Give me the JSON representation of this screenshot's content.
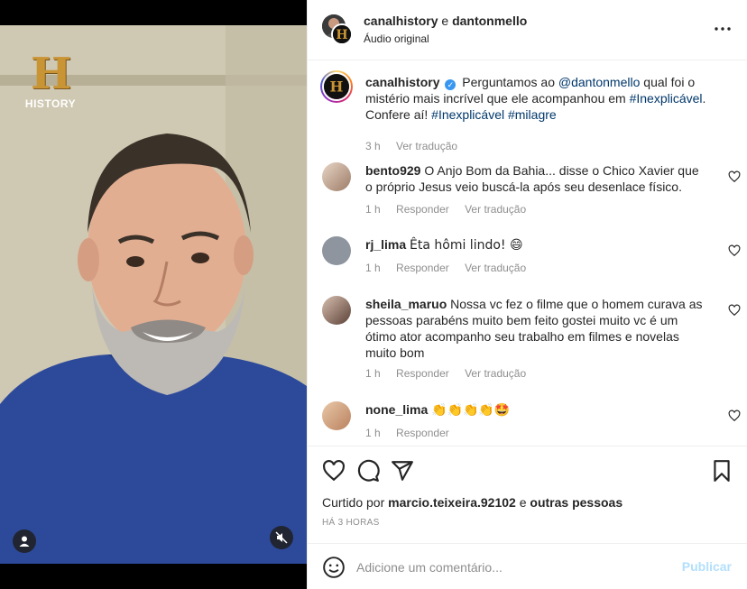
{
  "video": {
    "logo_text": "HISTORY",
    "logo_letter": "H"
  },
  "header": {
    "user1": "canalhistory",
    "joiner": "e",
    "user2": "dantonmello",
    "audio": "Áudio original"
  },
  "caption": {
    "user": "canalhistory",
    "text_1": "Perguntamos ao",
    "mention": "@dantonmello",
    "text_2": "qual foi o mistério mais incrível que ele acompanhou em",
    "tag1": "#Inexplicável",
    "text_3": ". Confere aí!",
    "tag2": "#Inexplicável",
    "tag3": "#milagre",
    "time": "3 h",
    "translate": "Ver tradução"
  },
  "comments": [
    {
      "user": "bento929",
      "text": "O Anjo Bom da Bahia... disse o Chico Xavier que o próprio Jesus veio buscá-la após seu desenlace físico.",
      "time": "1 h",
      "reply": "Responder",
      "translate": "Ver tradução"
    },
    {
      "user": "rj_lima",
      "text": "Êta hômi lindo! 😄",
      "time": "1 h",
      "reply": "Responder",
      "translate": "Ver tradução"
    },
    {
      "user": "sheila_maruo",
      "text": "Nossa vc fez o filme que o homem curava as pessoas parabéns muito bem feito gostei muito vc é um ótimo ator acompanho seu trabalho em filmes e novelas muito bom",
      "time": "1 h",
      "reply": "Responder",
      "translate": "Ver tradução"
    },
    {
      "user": "none_lima",
      "text": "👏👏👏👏🤩",
      "time": "1 h",
      "reply": "Responder"
    }
  ],
  "likes": {
    "prefix": "Curtido por",
    "user": "marcio.teixeira.92102",
    "joiner": "e",
    "others": "outras pessoas",
    "time": "HÁ 3 HORAS"
  },
  "add_comment": {
    "placeholder": "Adicione um comentário...",
    "post": "Publicar"
  },
  "colors": {
    "link": "#00376b",
    "verified": "#3897f0",
    "post_disabled": "#b2dffc"
  }
}
